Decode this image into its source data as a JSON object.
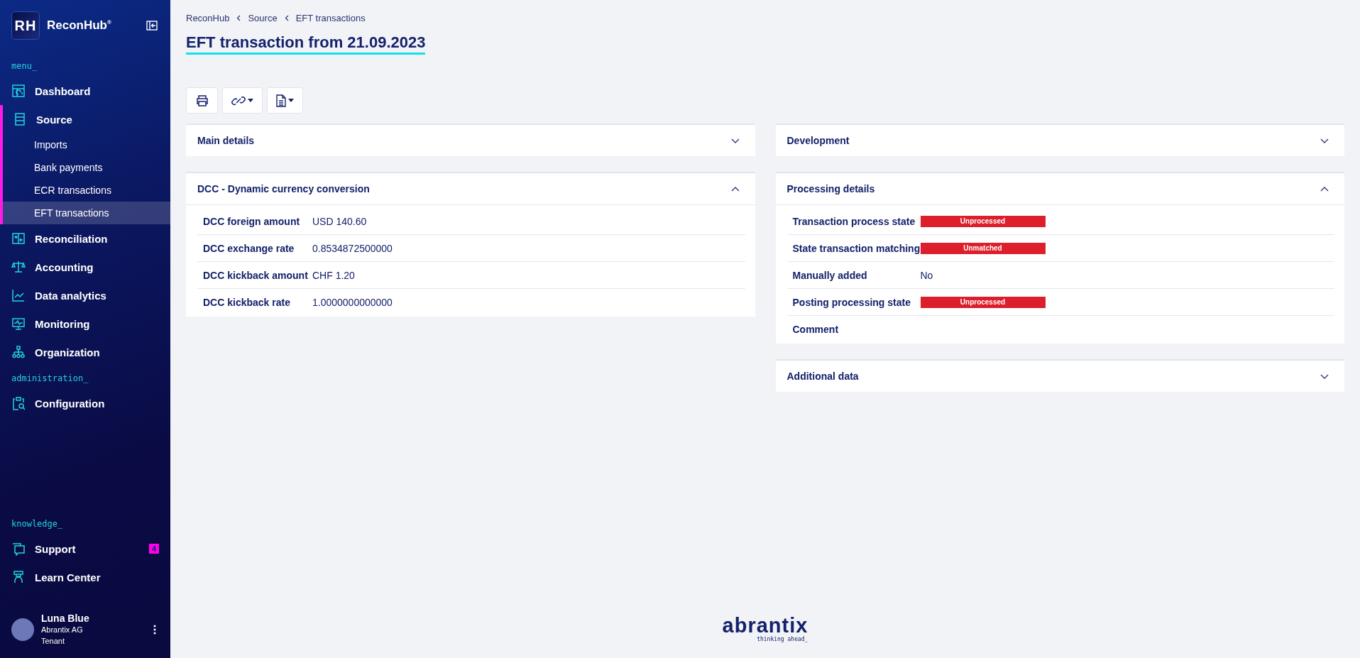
{
  "sidebar": {
    "logo": {
      "initials": "RH",
      "name": "ReconHub",
      "mark": "®"
    },
    "sections": [
      {
        "label": "menu_",
        "items": [
          {
            "label": "Dashboard",
            "kind": "dashboard"
          },
          {
            "label": "Source",
            "kind": "source",
            "expanded": true,
            "children": [
              {
                "label": "Imports",
                "selected": false
              },
              {
                "label": "Bank payments",
                "selected": false
              },
              {
                "label": "ECR transactions",
                "selected": false
              },
              {
                "label": "EFT transactions",
                "selected": true
              }
            ]
          },
          {
            "label": "Reconciliation",
            "kind": "reconciliation"
          },
          {
            "label": "Accounting",
            "kind": "scale"
          },
          {
            "label": "Data analytics",
            "kind": "chart"
          },
          {
            "label": "Monitoring",
            "kind": "monitor"
          },
          {
            "label": "Organization",
            "kind": "org"
          }
        ]
      },
      {
        "label": "administration_",
        "items": [
          {
            "label": "Configuration",
            "kind": "config"
          }
        ]
      },
      {
        "label": "knowledge_",
        "items": [
          {
            "label": "Support",
            "kind": "support",
            "badge": "4"
          },
          {
            "label": "Learn Center",
            "kind": "learn"
          }
        ]
      }
    ],
    "user": {
      "name": "Luna Blue",
      "company": "Abrantix AG",
      "role": "Tenant"
    }
  },
  "breadcrumb": [
    "ReconHub",
    "Source",
    "EFT transactions"
  ],
  "title": "EFT transaction from 21.09.2023",
  "toolbar": [
    {
      "kind": "print",
      "dropdown": false
    },
    {
      "kind": "link",
      "dropdown": true
    },
    {
      "kind": "document",
      "dropdown": true
    }
  ],
  "columns": [
    [
      {
        "title": "Main details",
        "expanded": false
      },
      {
        "title": "DCC - Dynamic currency conversion",
        "expanded": true,
        "rows": [
          {
            "label": "DCC foreign amount",
            "value": "USD 140.60",
            "kind": "text"
          },
          {
            "label": "DCC exchange rate",
            "value": "0.8534872500000",
            "kind": "text"
          },
          {
            "label": "DCC kickback amount",
            "value": "CHF 1.20",
            "kind": "text"
          },
          {
            "label": "DCC kickback rate",
            "value": "1.0000000000000",
            "kind": "text"
          }
        ]
      }
    ],
    [
      {
        "title": "Development",
        "expanded": false
      },
      {
        "title": "Processing details",
        "expanded": true,
        "rows": [
          {
            "label": "Transaction process state",
            "value": "Unprocessed",
            "kind": "status"
          },
          {
            "label": "State transaction matching",
            "value": "Unmatched",
            "kind": "status"
          },
          {
            "label": "Manually added",
            "value": "No",
            "kind": "text"
          },
          {
            "label": "Posting processing state",
            "value": "Unprocessed",
            "kind": "status"
          },
          {
            "label": "Comment"
          }
        ]
      },
      {
        "title": "Additional data",
        "expanded": false
      }
    ]
  ],
  "footer": {
    "brand": "abrantix",
    "tagline": "thinking ahead_"
  }
}
